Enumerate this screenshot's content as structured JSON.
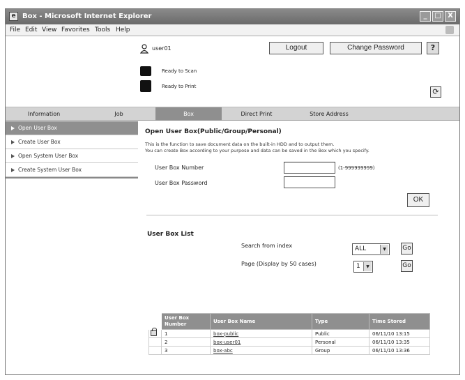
{
  "window": {
    "title": "Box - Microsoft Internet Explorer",
    "ie_glyph": "e"
  },
  "window_buttons": {
    "minimize": "_",
    "maximize": "□",
    "close": "X"
  },
  "menubar": {
    "items": [
      "File",
      "Edit",
      "View",
      "Favorites",
      "Tools",
      "Help"
    ]
  },
  "header": {
    "user": "user01",
    "logout_label": "Logout",
    "change_password_label": "Change Password",
    "help_glyph": "?",
    "refresh_glyph": "⟳"
  },
  "status": {
    "scan": "Ready to Scan",
    "print": "Ready to Print"
  },
  "tabs": [
    "Information",
    "Job",
    "Box",
    "Direct Print",
    "Store Address"
  ],
  "sidebar": {
    "items": [
      "Open User Box",
      "Create User Box",
      "Open System User Box",
      "Create System User Box"
    ]
  },
  "main": {
    "title": "Open User Box(Public/Group/Personal)",
    "desc1": "This is the function to save document data on the built-in HDD and to output them.",
    "desc2": "You can create Box according to your purpose and data can be saved in the Box which you specify.",
    "box_number_label": "User Box Number",
    "box_number_value": "",
    "box_number_hint": "(1-999999999)",
    "box_password_label": "User Box Password",
    "box_password_value": "",
    "ok_label": "OK"
  },
  "list": {
    "title": "User Box List",
    "search_label": "Search from index",
    "search_value": "ALL",
    "page_label": "Page (Display by 50 cases)",
    "page_value": "1",
    "go_label": "Go",
    "columns": [
      "User Box Number",
      "User Box Name",
      "Type",
      "Time Stored"
    ],
    "rows": [
      {
        "number": "1",
        "name": "box-public",
        "type": "Public",
        "time": "06/11/10 13:15",
        "locked": true
      },
      {
        "number": "2",
        "name": "box-user01",
        "type": "Personal",
        "time": "06/11/10 13:35",
        "locked": false
      },
      {
        "number": "3",
        "name": "box-abc",
        "type": "Group",
        "time": "06/11/10 13:36",
        "locked": false
      }
    ]
  }
}
